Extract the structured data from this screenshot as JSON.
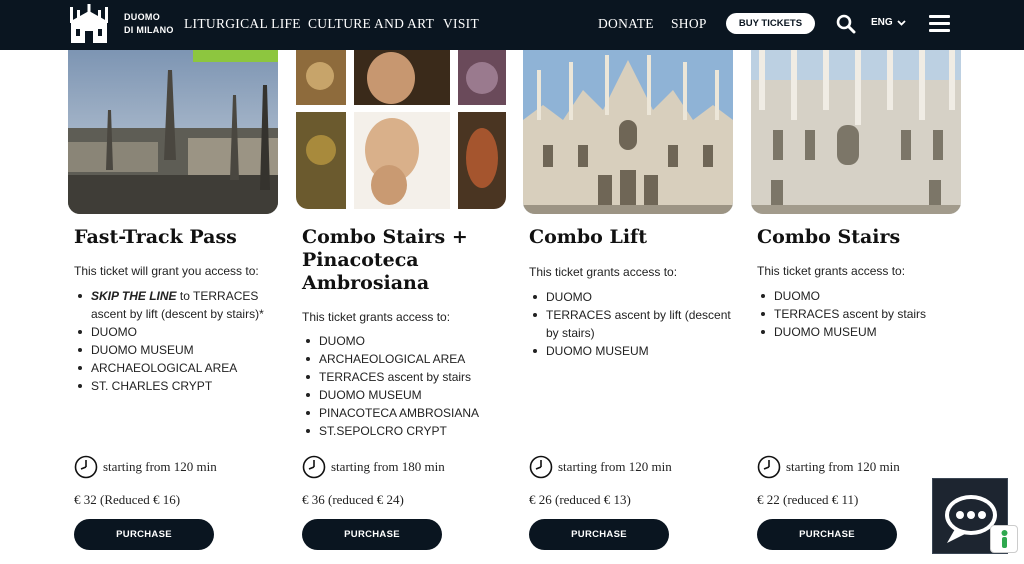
{
  "nav": {
    "logo_line1": "DUOMO",
    "logo_line2": "DI MILANO",
    "links": [
      "LITURGICAL LIFE",
      "CULTURE AND ART",
      "VISIT"
    ],
    "donate": "DONATE",
    "shop": "SHOP",
    "buy_tickets": "BUY TICKETS",
    "lang": "ENG"
  },
  "cards": [
    {
      "title": "Fast-Track Pass",
      "intro": "This ticket will grant you access to:",
      "items": [
        {
          "em": "SKIP THE LINE",
          "text": " to TERRACES ascent by lift (descent by stairs)*"
        },
        {
          "text": "DUOMO"
        },
        {
          "text": "DUOMO MUSEUM"
        },
        {
          "text": "ARCHAEOLOGICAL AREA"
        },
        {
          "text": "ST. CHARLES CRYPT"
        }
      ],
      "duration": "starting from 120 min",
      "price": "€ 32 (Reduced € 16)",
      "purchase": "PURCHASE"
    },
    {
      "title": "Combo Stairs + Pinacoteca Ambrosiana",
      "intro": "This ticket grants access to:",
      "items": [
        {
          "text": "DUOMO"
        },
        {
          "text": "ARCHAEOLOGICAL AREA"
        },
        {
          "text": "TERRACES ascent by stairs"
        },
        {
          "text": "DUOMO MUSEUM"
        },
        {
          "text": "PINACOTECA AMBROSIANA"
        },
        {
          "text": "ST.SEPOLCRO CRYPT"
        }
      ],
      "duration": "starting from 180 min",
      "price": "€ 36 (reduced € 24)",
      "purchase": "PURCHASE"
    },
    {
      "title": "Combo Lift",
      "intro": "This ticket grants access to:",
      "items": [
        {
          "text": "DUOMO"
        },
        {
          "text": "TERRACES ascent by lift (descent by stairs)"
        },
        {
          "text": "DUOMO MUSEUM"
        }
      ],
      "duration": "starting from 120 min",
      "price": "€ 26 (reduced € 13)",
      "purchase": "PURCHASE"
    },
    {
      "title": "Combo Stairs",
      "intro": "This ticket grants access to:",
      "items": [
        {
          "text": "DUOMO"
        },
        {
          "text": "TERRACES ascent by stairs"
        },
        {
          "text": "DUOMO MUSEUM"
        }
      ],
      "duration": "starting from 120 min",
      "price": "€ 22 (reduced € 11)",
      "purchase": "PURCHASE"
    }
  ],
  "colors": {
    "nav_bg": "#0a1520",
    "button_bg": "#0a1520",
    "badge_green": "#8dc63f"
  },
  "icons": [
    "duomo-logo-icon",
    "search-icon",
    "chevron-down-icon",
    "hamburger-menu-icon",
    "clock-icon",
    "chat-icon",
    "scroll-indicator-icon"
  ]
}
